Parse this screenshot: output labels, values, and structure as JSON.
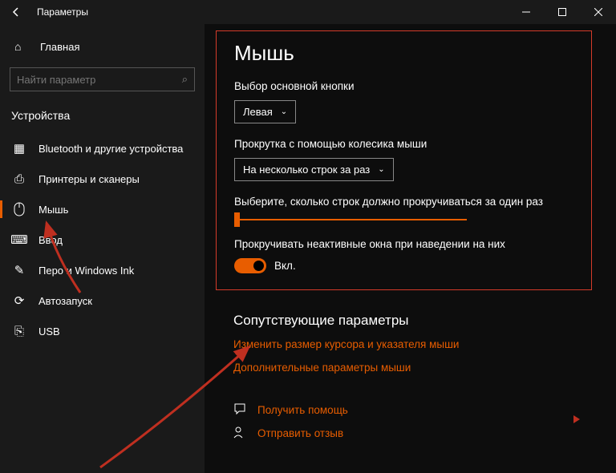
{
  "titlebar": {
    "title": "Параметры"
  },
  "sidebar": {
    "home": "Главная",
    "search_placeholder": "Найти параметр",
    "category": "Устройства",
    "items": [
      {
        "label": "Bluetooth и другие устройства"
      },
      {
        "label": "Принтеры и сканеры"
      },
      {
        "label": "Мышь"
      },
      {
        "label": "Ввод"
      },
      {
        "label": "Перо и Windows Ink"
      },
      {
        "label": "Автозапуск"
      },
      {
        "label": "USB"
      }
    ]
  },
  "main": {
    "title": "Мышь",
    "primary_label": "Выбор основной кнопки",
    "primary_value": "Левая",
    "scroll_label": "Прокрутка с помощью колесика мыши",
    "scroll_value": "На несколько строк за раз",
    "lines_label": "Выберите, сколько строк должно прокручиваться за один раз",
    "inactive_label": "Прокручивать неактивные окна при наведении на них",
    "toggle_state": "Вкл."
  },
  "related": {
    "heading": "Сопутствующие параметры",
    "link1": "Изменить размер курсора и указателя мыши",
    "link2": "Дополнительные параметры мыши",
    "help": "Получить помощь",
    "feedback": "Отправить отзыв"
  }
}
